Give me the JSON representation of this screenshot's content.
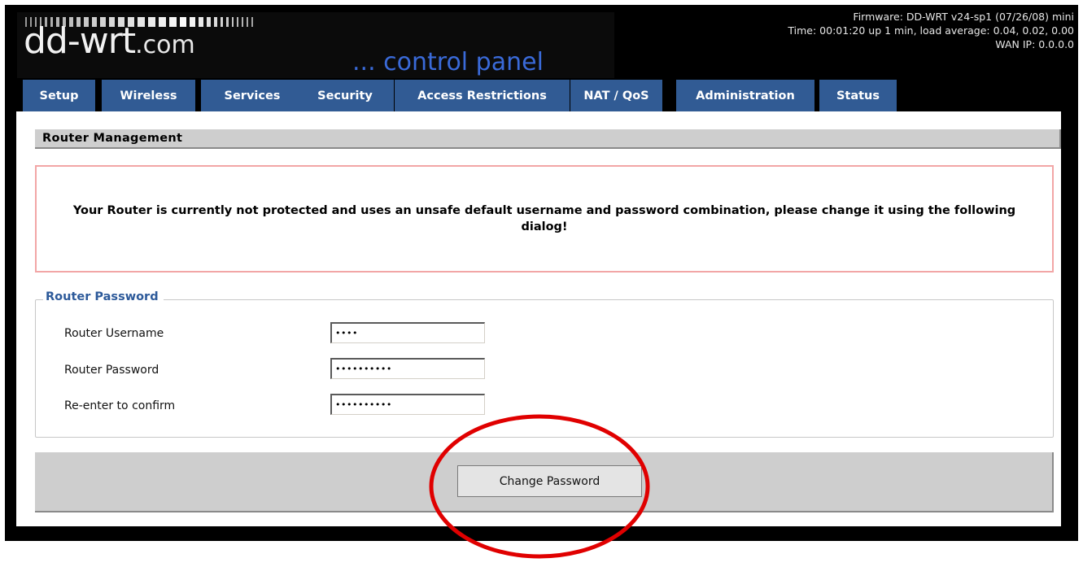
{
  "header": {
    "logo_main": "dd-wrt",
    "logo_com": ".com",
    "logo_sub": "... control panel",
    "firmware": "Firmware: DD-WRT v24-sp1 (07/26/08) mini",
    "time": "Time: 00:01:20 up 1 min, load average: 0.04, 0.02, 0.00",
    "wan_ip": "WAN IP: 0.0.0.0"
  },
  "tabs": [
    {
      "label": "Setup"
    },
    {
      "label": "Wireless"
    },
    {
      "label": "Services"
    },
    {
      "label": "Security"
    },
    {
      "label": "Access Restrictions"
    },
    {
      "label": "NAT / QoS"
    },
    {
      "label": "Administration"
    },
    {
      "label": "Status"
    }
  ],
  "main": {
    "section_title": "Router Management",
    "warning_text": "Your Router is currently not protected and uses an unsafe default username and password combination, please change it using the following dialog!",
    "fieldset_legend": "Router Password",
    "fields": [
      {
        "label": "Router Username",
        "value": "••••"
      },
      {
        "label": "Router Password",
        "value": "••••••••••"
      },
      {
        "label": "Re-enter to confirm",
        "value": "••••••••••"
      }
    ],
    "button_label": "Change Password"
  },
  "colors": {
    "tab_bg": "#315b94",
    "legend": "#2d5a9a",
    "warning_border": "#f2a6a6",
    "annotation": "#e00000"
  }
}
